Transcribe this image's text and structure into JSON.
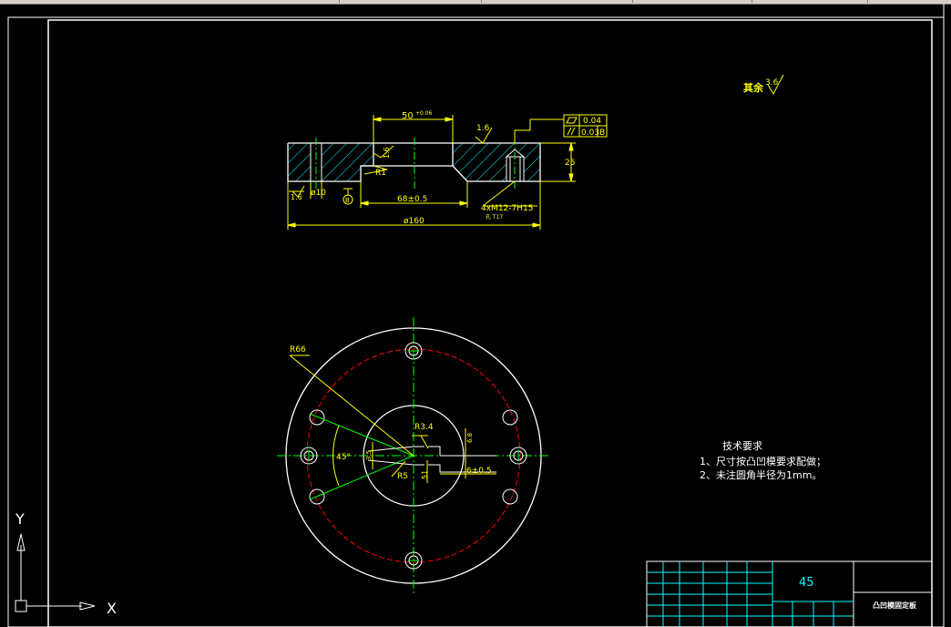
{
  "colors": {
    "background": "#000000",
    "frame": "#ffffff",
    "dimension": "#ffff00",
    "center_line": "#00ff00",
    "hidden_pitch_circle": "#ff0000",
    "hatch": "#00ffff",
    "title_block": "#00ffff"
  },
  "top_view": {
    "dim_top": "50",
    "dim_top_tol": "+0.06",
    "roughness_top": "1.6",
    "flatness_value": "0.04",
    "parallel_value": "0.03",
    "datum_ref": "B",
    "roughness_side": "1.6",
    "radius_r1": "R1",
    "dim_height": "25",
    "roughness_left": "1.6",
    "dia_hole": "ø10",
    "datum_b": "B",
    "dim_inner": "68±0.5",
    "thread_callout": "4xM12-7H15",
    "thread_sub": "孔 T17",
    "dia_outer": "ø160"
  },
  "roughness_note": {
    "prefix": "其余",
    "value": "3.6"
  },
  "plan_view": {
    "r66": "R66",
    "r34": "R3.4",
    "r5": "R5",
    "angle": "45°",
    "dim_6_5": "6±0.5",
    "dim_51": "51",
    "dim_vert": "6.8",
    "dim_small": "3.5"
  },
  "tech_notes": {
    "title": "技术要求",
    "line1": "1、尺寸按凸凹模要求配做；",
    "line2": "2、未注圆角半径为1mm。"
  },
  "title_block": {
    "material": "45",
    "part_name": "凸凹模固定板"
  },
  "ucs": {
    "x_label": "X",
    "y_label": "Y"
  }
}
